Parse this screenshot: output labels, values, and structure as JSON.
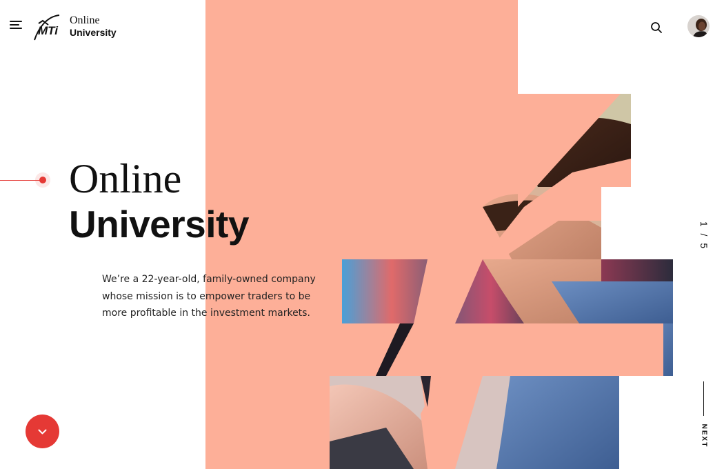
{
  "header": {
    "brand_line1": "Online",
    "brand_line2": "University",
    "logo_text": "MTi",
    "icons": [
      "menu-icon",
      "search-icon",
      "user-avatar"
    ]
  },
  "hero": {
    "title_line1": "Online",
    "title_line2": "University",
    "description": "We’re a 22-year-old, family-owned company whose mission is to empower traders to be more profitable in the investment markets."
  },
  "slider": {
    "counter": "1 / 5",
    "next_label": "NEXT"
  },
  "scroll_button_icon": "chevron-down-icon",
  "colors": {
    "accent": "#e53935",
    "salmon": "#fdaf98",
    "text": "#111111",
    "background": "#ffffff"
  }
}
